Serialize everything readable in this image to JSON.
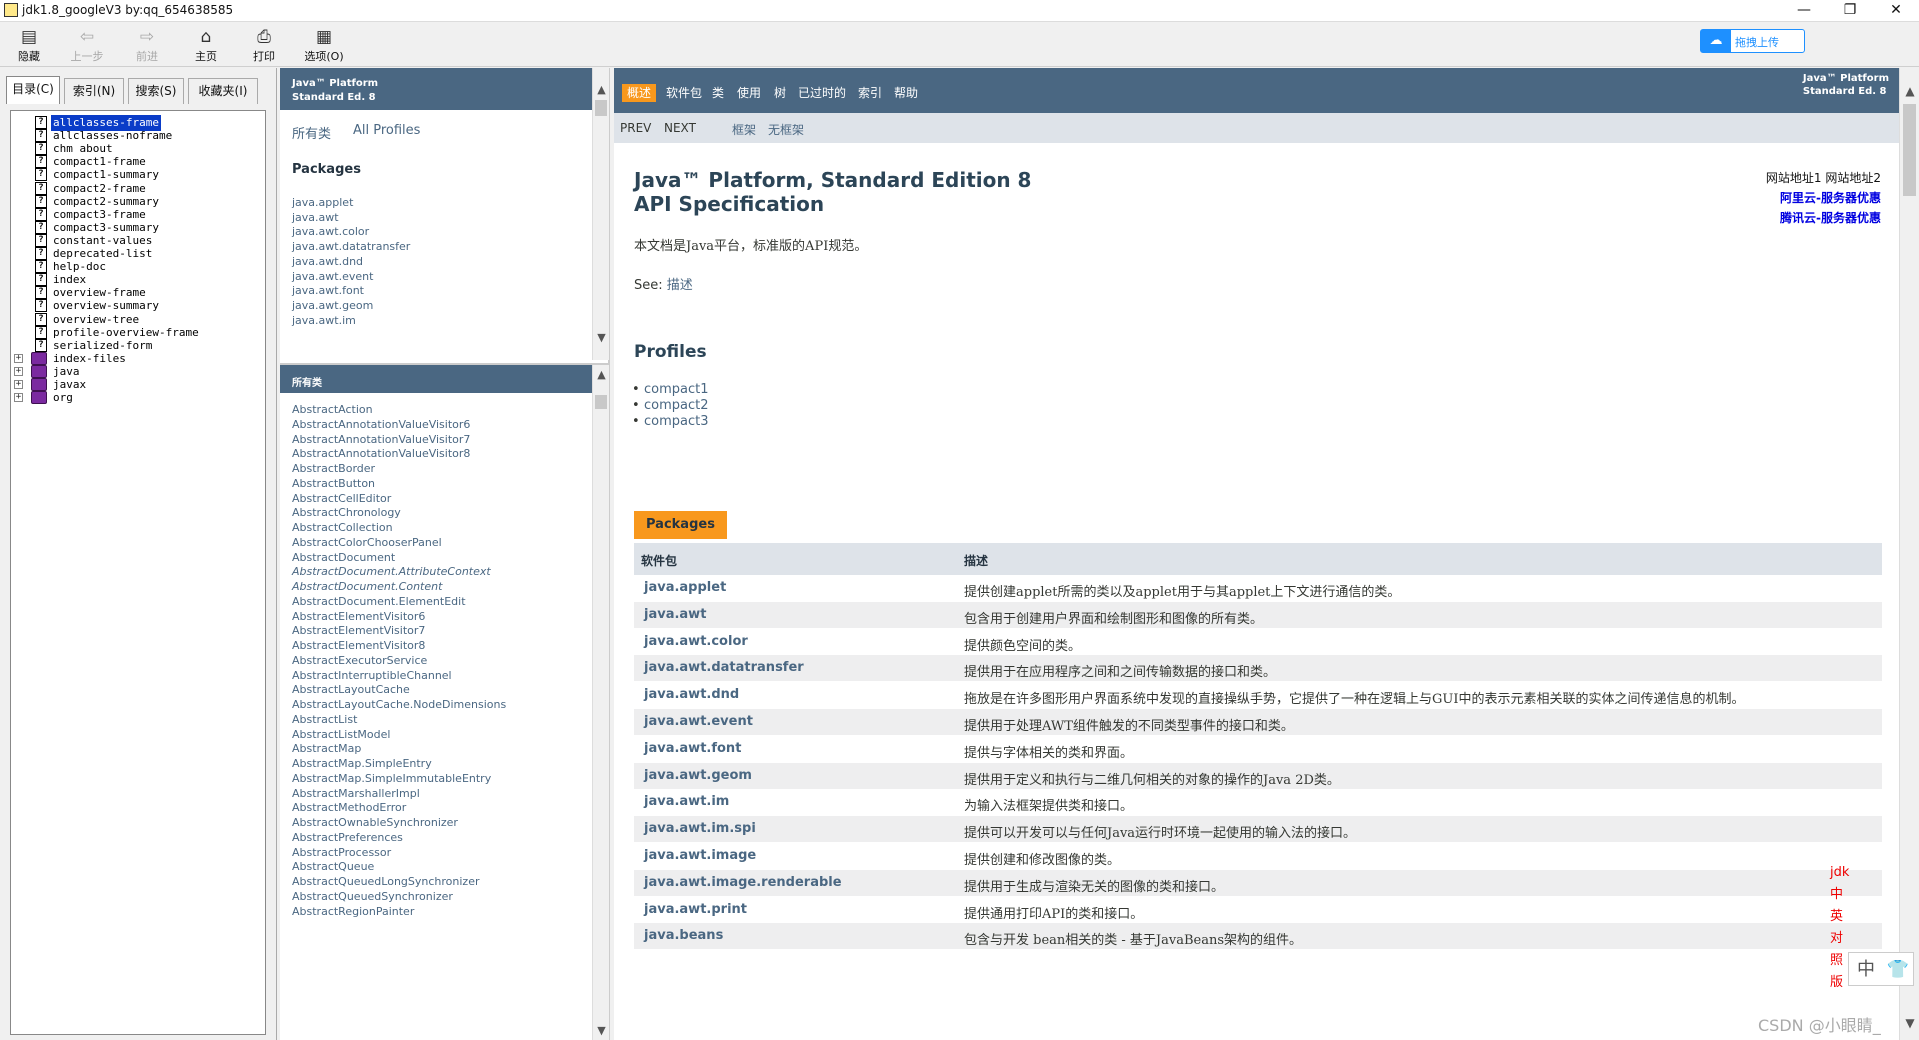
{
  "window": {
    "title": "jdk1.8_googleV3 by:qq_654638585",
    "controls": [
      "—",
      "❐",
      "✕"
    ]
  },
  "toolbar": {
    "buttons": [
      {
        "label": "隐藏",
        "icon": "hide-icon"
      },
      {
        "label": "上一步",
        "icon": "back-arrow-icon"
      },
      {
        "label": "前进",
        "icon": "forward-arrow-icon"
      },
      {
        "label": "主页",
        "icon": "home-icon"
      },
      {
        "label": "打印",
        "icon": "printer-icon"
      },
      {
        "label": "选项(O)",
        "icon": "options-icon"
      }
    ],
    "upload_label": "拖拽上传"
  },
  "left_tabs": [
    "目录(C)",
    "索引(N)",
    "搜索(S)",
    "收藏夹(I)"
  ],
  "tree": [
    {
      "label": "allclasses-frame",
      "type": "page",
      "selected": true
    },
    {
      "label": "allclasses-noframe",
      "type": "page"
    },
    {
      "label": "chm about",
      "type": "page"
    },
    {
      "label": "compact1-frame",
      "type": "page"
    },
    {
      "label": "compact1-summary",
      "type": "page"
    },
    {
      "label": "compact2-frame",
      "type": "page"
    },
    {
      "label": "compact2-summary",
      "type": "page"
    },
    {
      "label": "compact3-frame",
      "type": "page"
    },
    {
      "label": "compact3-summary",
      "type": "page"
    },
    {
      "label": "constant-values",
      "type": "page"
    },
    {
      "label": "deprecated-list",
      "type": "page"
    },
    {
      "label": "help-doc",
      "type": "page"
    },
    {
      "label": "index",
      "type": "page"
    },
    {
      "label": "overview-frame",
      "type": "page"
    },
    {
      "label": "overview-summary",
      "type": "page"
    },
    {
      "label": "overview-tree",
      "type": "page"
    },
    {
      "label": "profile-overview-frame",
      "type": "page"
    },
    {
      "label": "serialized-form",
      "type": "page"
    },
    {
      "label": "index-files",
      "type": "book"
    },
    {
      "label": "java",
      "type": "book"
    },
    {
      "label": "javax",
      "type": "book"
    },
    {
      "label": "org",
      "type": "book"
    }
  ],
  "icons": {
    "page_glyph": "?",
    "expand_glyph": "+"
  },
  "platform_header": {
    "line1": "Java™ Platform",
    "line2": "Standard Ed. 8"
  },
  "packages_frame": {
    "links": [
      "所有类",
      "All Profiles"
    ],
    "heading": "Packages",
    "items": [
      "java.applet",
      "java.awt",
      "java.awt.color",
      "java.awt.datatransfer",
      "java.awt.dnd",
      "java.awt.event",
      "java.awt.font",
      "java.awt.geom",
      "java.awt.im"
    ]
  },
  "classes_frame": {
    "header": "所有类",
    "items": [
      {
        "name": "AbstractAction"
      },
      {
        "name": "AbstractAnnotationValueVisitor6"
      },
      {
        "name": "AbstractAnnotationValueVisitor7"
      },
      {
        "name": "AbstractAnnotationValueVisitor8"
      },
      {
        "name": "AbstractBorder"
      },
      {
        "name": "AbstractButton"
      },
      {
        "name": "AbstractCellEditor"
      },
      {
        "name": "AbstractChronology"
      },
      {
        "name": "AbstractCollection"
      },
      {
        "name": "AbstractColorChooserPanel"
      },
      {
        "name": "AbstractDocument"
      },
      {
        "name": "AbstractDocument.AttributeContext",
        "italic": true
      },
      {
        "name": "AbstractDocument.Content",
        "italic": true
      },
      {
        "name": "AbstractDocument.ElementEdit"
      },
      {
        "name": "AbstractElementVisitor6"
      },
      {
        "name": "AbstractElementVisitor7"
      },
      {
        "name": "AbstractElementVisitor8"
      },
      {
        "name": "AbstractExecutorService"
      },
      {
        "name": "AbstractInterruptibleChannel"
      },
      {
        "name": "AbstractLayoutCache"
      },
      {
        "name": "AbstractLayoutCache.NodeDimensions"
      },
      {
        "name": "AbstractList"
      },
      {
        "name": "AbstractListModel"
      },
      {
        "name": "AbstractMap"
      },
      {
        "name": "AbstractMap.SimpleEntry"
      },
      {
        "name": "AbstractMap.SimpleImmutableEntry"
      },
      {
        "name": "AbstractMarshallerImpl"
      },
      {
        "name": "AbstractMethodError"
      },
      {
        "name": "AbstractOwnableSynchronizer"
      },
      {
        "name": "AbstractPreferences"
      },
      {
        "name": "AbstractProcessor"
      },
      {
        "name": "AbstractQueue"
      },
      {
        "name": "AbstractQueuedLongSynchronizer"
      },
      {
        "name": "AbstractQueuedSynchronizer"
      },
      {
        "name": "AbstractRegionPainter"
      }
    ]
  },
  "topnav": {
    "items": [
      "概述",
      "软件包",
      "类",
      "使用",
      "树",
      "已过时的",
      "索引",
      "帮助"
    ],
    "active": 0
  },
  "subnav": {
    "prev": "PREV",
    "next": "NEXT",
    "frames": "框架",
    "noframes": "无框架"
  },
  "content": {
    "title_line1": "Java™ Platform, Standard Edition 8",
    "title_line2": "API Specification",
    "intro": "本文档是Java平台，标准版的API规范。",
    "see_label": "See: ",
    "see_link": "描述",
    "profiles_heading": "Profiles",
    "profiles": [
      "compact1",
      "compact2",
      "compact3"
    ],
    "side_plain": "网站地址1  网站地址2",
    "side_links": [
      "阿里云-服务器优惠",
      "腾讯云-服务器优惠"
    ],
    "packages_caption": "Packages",
    "table_headers": [
      "软件包",
      "描述"
    ],
    "rows": [
      {
        "pkg": "java.applet",
        "desc": "提供创建applet所需的类以及applet用于与其applet上下文进行通信的类。"
      },
      {
        "pkg": "java.awt",
        "desc": "包含用于创建用户界面和绘制图形和图像的所有类。"
      },
      {
        "pkg": "java.awt.color",
        "desc": "提供颜色空间的类。"
      },
      {
        "pkg": "java.awt.datatransfer",
        "desc": "提供用于在应用程序之间和之间传输数据的接口和类。"
      },
      {
        "pkg": "java.awt.dnd",
        "desc": "拖放是在许多图形用户界面系统中发现的直接操纵手势，它提供了一种在逻辑上与GUI中的表示元素相关联的实体之间传递信息的机制。"
      },
      {
        "pkg": "java.awt.event",
        "desc": "提供用于处理AWT组件触发的不同类型事件的接口和类。"
      },
      {
        "pkg": "java.awt.font",
        "desc": "提供与字体相关的类和界面。"
      },
      {
        "pkg": "java.awt.geom",
        "desc": "提供用于定义和执行与二维几何相关的对象的操作的Java 2D类。"
      },
      {
        "pkg": "java.awt.im",
        "desc": "为输入法框架提供类和接口。"
      },
      {
        "pkg": "java.awt.im.spi",
        "desc": "提供可以开发可以与任何Java运行时环境一起使用的输入法的接口。"
      },
      {
        "pkg": "java.awt.image",
        "desc": "提供创建和修改图像的类。"
      },
      {
        "pkg": "java.awt.image.renderable",
        "desc": "提供用于生成与渲染无关的图像的类和接口。"
      },
      {
        "pkg": "java.awt.print",
        "desc": "提供通用打印API的类和接口。"
      },
      {
        "pkg": "java.beans",
        "desc": "包含与开发 bean相关的类 - 基于JavaBeans架构的组件。"
      }
    ]
  },
  "badge": [
    "jdk",
    "中",
    "英",
    "对",
    "照",
    "版"
  ],
  "float_buttons": [
    "中",
    "👕"
  ],
  "watermark": "CSDN @小眼睛_"
}
